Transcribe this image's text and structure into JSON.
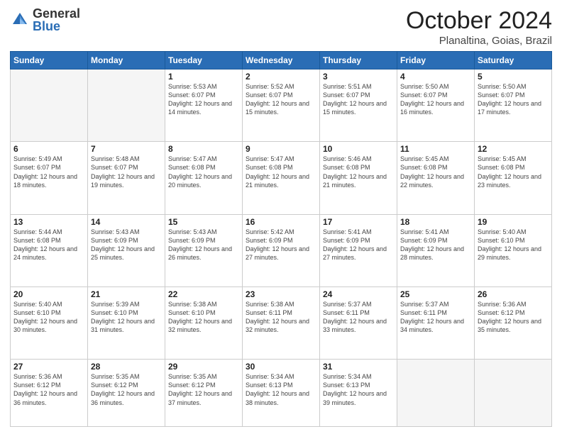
{
  "logo": {
    "general": "General",
    "blue": "Blue"
  },
  "header": {
    "month": "October 2024",
    "location": "Planaltina, Goias, Brazil"
  },
  "days_of_week": [
    "Sunday",
    "Monday",
    "Tuesday",
    "Wednesday",
    "Thursday",
    "Friday",
    "Saturday"
  ],
  "weeks": [
    [
      {
        "day": "",
        "empty": true
      },
      {
        "day": "",
        "empty": true
      },
      {
        "day": "1",
        "sunrise": "5:53 AM",
        "sunset": "6:07 PM",
        "daylight": "12 hours and 14 minutes."
      },
      {
        "day": "2",
        "sunrise": "5:52 AM",
        "sunset": "6:07 PM",
        "daylight": "12 hours and 15 minutes."
      },
      {
        "day": "3",
        "sunrise": "5:51 AM",
        "sunset": "6:07 PM",
        "daylight": "12 hours and 15 minutes."
      },
      {
        "day": "4",
        "sunrise": "5:50 AM",
        "sunset": "6:07 PM",
        "daylight": "12 hours and 16 minutes."
      },
      {
        "day": "5",
        "sunrise": "5:50 AM",
        "sunset": "6:07 PM",
        "daylight": "12 hours and 17 minutes."
      }
    ],
    [
      {
        "day": "6",
        "sunrise": "5:49 AM",
        "sunset": "6:07 PM",
        "daylight": "12 hours and 18 minutes."
      },
      {
        "day": "7",
        "sunrise": "5:48 AM",
        "sunset": "6:07 PM",
        "daylight": "12 hours and 19 minutes."
      },
      {
        "day": "8",
        "sunrise": "5:47 AM",
        "sunset": "6:08 PM",
        "daylight": "12 hours and 20 minutes."
      },
      {
        "day": "9",
        "sunrise": "5:47 AM",
        "sunset": "6:08 PM",
        "daylight": "12 hours and 21 minutes."
      },
      {
        "day": "10",
        "sunrise": "5:46 AM",
        "sunset": "6:08 PM",
        "daylight": "12 hours and 21 minutes."
      },
      {
        "day": "11",
        "sunrise": "5:45 AM",
        "sunset": "6:08 PM",
        "daylight": "12 hours and 22 minutes."
      },
      {
        "day": "12",
        "sunrise": "5:45 AM",
        "sunset": "6:08 PM",
        "daylight": "12 hours and 23 minutes."
      }
    ],
    [
      {
        "day": "13",
        "sunrise": "5:44 AM",
        "sunset": "6:08 PM",
        "daylight": "12 hours and 24 minutes."
      },
      {
        "day": "14",
        "sunrise": "5:43 AM",
        "sunset": "6:09 PM",
        "daylight": "12 hours and 25 minutes."
      },
      {
        "day": "15",
        "sunrise": "5:43 AM",
        "sunset": "6:09 PM",
        "daylight": "12 hours and 26 minutes."
      },
      {
        "day": "16",
        "sunrise": "5:42 AM",
        "sunset": "6:09 PM",
        "daylight": "12 hours and 27 minutes."
      },
      {
        "day": "17",
        "sunrise": "5:41 AM",
        "sunset": "6:09 PM",
        "daylight": "12 hours and 27 minutes."
      },
      {
        "day": "18",
        "sunrise": "5:41 AM",
        "sunset": "6:09 PM",
        "daylight": "12 hours and 28 minutes."
      },
      {
        "day": "19",
        "sunrise": "5:40 AM",
        "sunset": "6:10 PM",
        "daylight": "12 hours and 29 minutes."
      }
    ],
    [
      {
        "day": "20",
        "sunrise": "5:40 AM",
        "sunset": "6:10 PM",
        "daylight": "12 hours and 30 minutes."
      },
      {
        "day": "21",
        "sunrise": "5:39 AM",
        "sunset": "6:10 PM",
        "daylight": "12 hours and 31 minutes."
      },
      {
        "day": "22",
        "sunrise": "5:38 AM",
        "sunset": "6:10 PM",
        "daylight": "12 hours and 32 minutes."
      },
      {
        "day": "23",
        "sunrise": "5:38 AM",
        "sunset": "6:11 PM",
        "daylight": "12 hours and 32 minutes."
      },
      {
        "day": "24",
        "sunrise": "5:37 AM",
        "sunset": "6:11 PM",
        "daylight": "12 hours and 33 minutes."
      },
      {
        "day": "25",
        "sunrise": "5:37 AM",
        "sunset": "6:11 PM",
        "daylight": "12 hours and 34 minutes."
      },
      {
        "day": "26",
        "sunrise": "5:36 AM",
        "sunset": "6:12 PM",
        "daylight": "12 hours and 35 minutes."
      }
    ],
    [
      {
        "day": "27",
        "sunrise": "5:36 AM",
        "sunset": "6:12 PM",
        "daylight": "12 hours and 36 minutes."
      },
      {
        "day": "28",
        "sunrise": "5:35 AM",
        "sunset": "6:12 PM",
        "daylight": "12 hours and 36 minutes."
      },
      {
        "day": "29",
        "sunrise": "5:35 AM",
        "sunset": "6:12 PM",
        "daylight": "12 hours and 37 minutes."
      },
      {
        "day": "30",
        "sunrise": "5:34 AM",
        "sunset": "6:13 PM",
        "daylight": "12 hours and 38 minutes."
      },
      {
        "day": "31",
        "sunrise": "5:34 AM",
        "sunset": "6:13 PM",
        "daylight": "12 hours and 39 minutes."
      },
      {
        "day": "",
        "empty": true
      },
      {
        "day": "",
        "empty": true
      }
    ]
  ]
}
